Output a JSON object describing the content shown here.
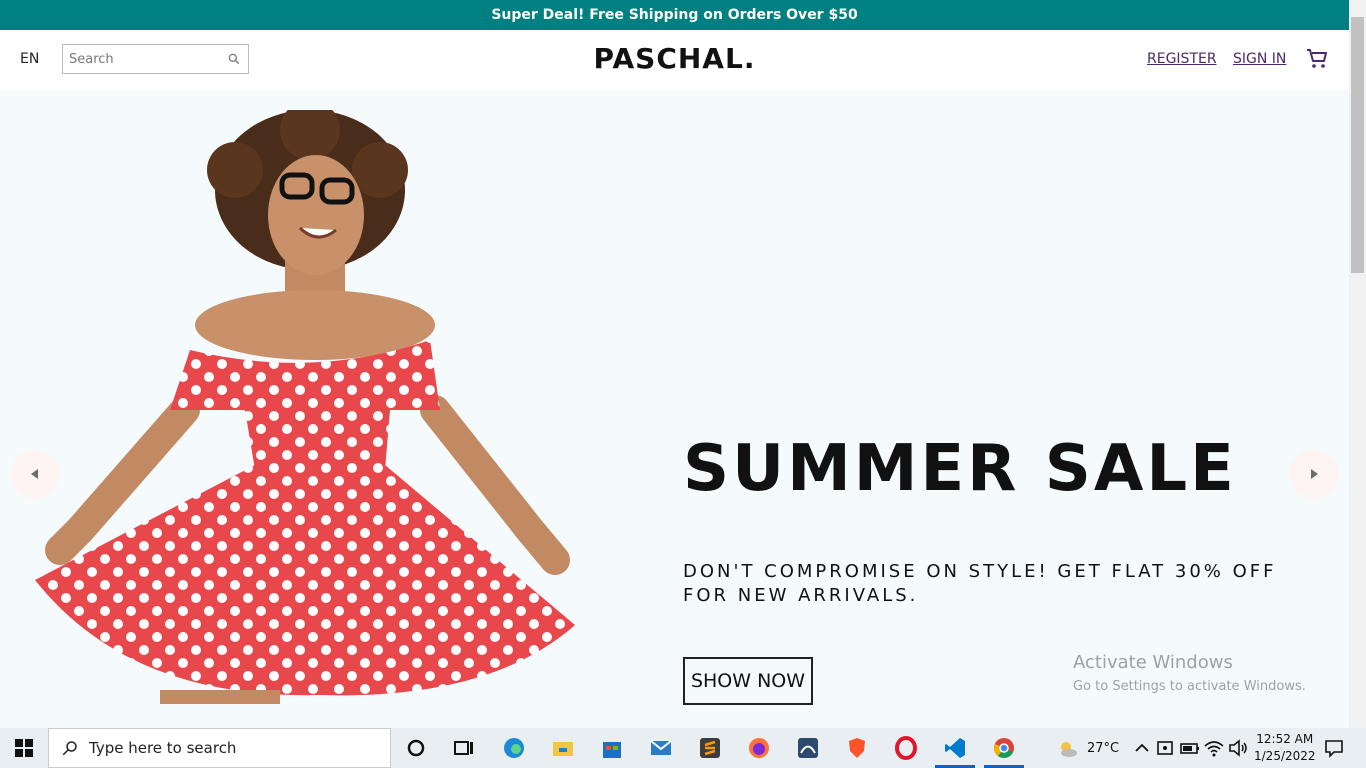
{
  "announcement": "Super Deal! Free Shipping on Orders Over $50",
  "navbar": {
    "language": "EN",
    "search_placeholder": "Search",
    "logo": "PASCHAL.",
    "register": "REGISTER",
    "sign_in": "SIGN IN"
  },
  "slider": {
    "title": "SUMMER SALE",
    "description": "DON'T COMPROMISE ON STYLE! GET FLAT 30% OFF FOR NEW ARRIVALS.",
    "button": "SHOW NOW"
  },
  "watermark": {
    "title": "Activate Windows",
    "subtitle": "Go to Settings to activate Windows."
  },
  "taskbar": {
    "search_placeholder": "Type here to search",
    "weather": "27°C",
    "time": "12:52 AM",
    "date": "1/25/2022"
  },
  "colors": {
    "announcement_bg": "#008080",
    "hero_bg": "#f5fbfd",
    "link": "#4b2a6b",
    "dress": "#e8474b"
  }
}
